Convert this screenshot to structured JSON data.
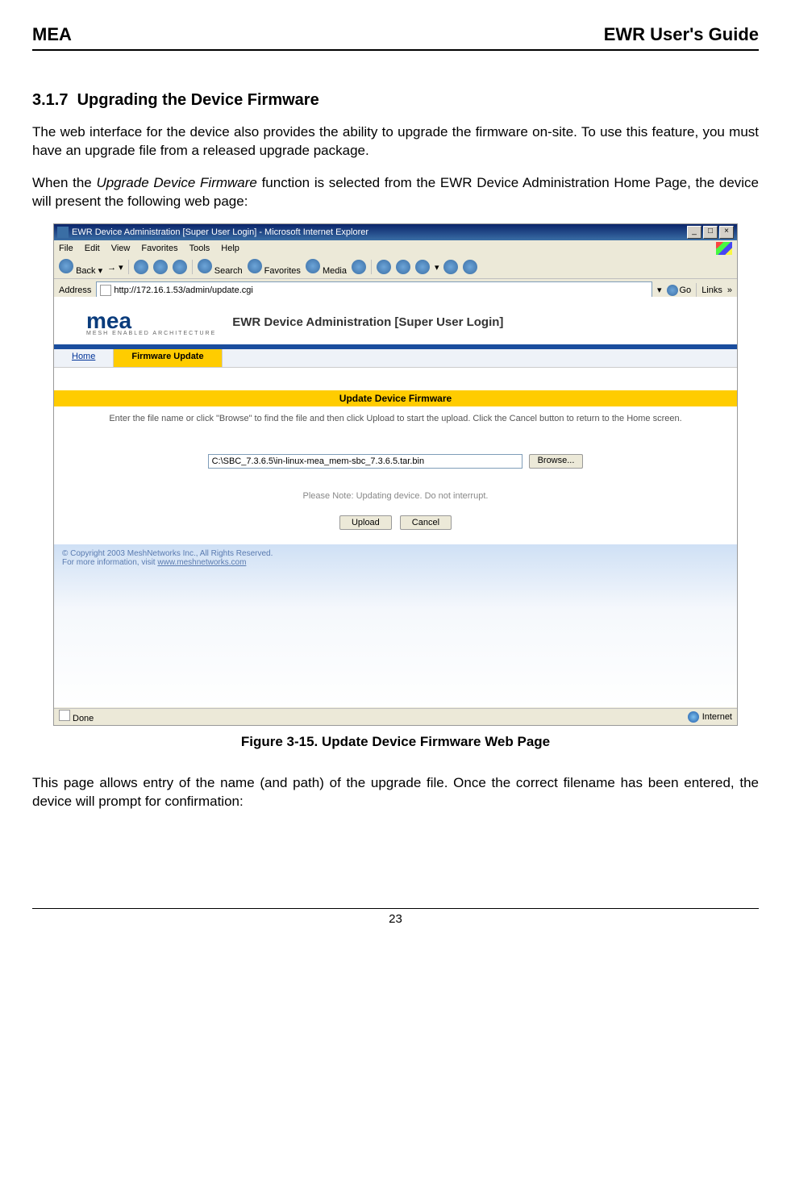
{
  "header": {
    "left": "MEA",
    "right": "EWR User's Guide"
  },
  "section": {
    "number": "3.1.7",
    "title": "Upgrading the Device Firmware"
  },
  "para1": "The web interface for the device also provides the ability to upgrade the firmware on-site. To use this feature, you must have an upgrade file from a released upgrade package.",
  "para2_prefix": "When the ",
  "para2_italic": "Upgrade Device Firmware",
  "para2_suffix": " function is selected from the EWR Device Administration Home Page, the device will present the following web page:",
  "browser": {
    "title": "EWR Device Administration [Super User Login] - Microsoft Internet Explorer",
    "menus": [
      "File",
      "Edit",
      "View",
      "Favorites",
      "Tools",
      "Help"
    ],
    "toolbar": {
      "back": "Back",
      "search": "Search",
      "favorites": "Favorites",
      "media": "Media"
    },
    "address_label": "Address",
    "address_value": "http://172.16.1.53/admin/update.cgi",
    "go": "Go",
    "links": "Links",
    "status_left": "Done",
    "status_right": "Internet"
  },
  "page": {
    "logo_text": "mea",
    "logo_sub": "MESH ENABLED ARCHITECTURE",
    "admin_title": "EWR Device Administration [Super User Login]",
    "tabs": {
      "home": "Home",
      "firmware": "Firmware Update"
    },
    "panel_title": "Update Device Firmware",
    "instructions": "Enter the file name or click \"Browse\" to find the file and then click Upload to start the upload. Click the Cancel button to return to the Home screen.",
    "file_value": "C:\\SBC_7.3.6.5\\in-linux-mea_mem-sbc_7.3.6.5.tar.bin",
    "browse_label": "Browse...",
    "note": "Please Note: Updating device. Do not interrupt.",
    "upload_label": "Upload",
    "cancel_label": "Cancel",
    "copyright": "© Copyright 2003 MeshNetworks Inc., All Rights Reserved.",
    "moreinfo_prefix": "For more information, visit ",
    "moreinfo_link": "www.meshnetworks.com"
  },
  "figure_caption": "Figure 3-15.   Update Device Firmware Web Page",
  "para3": "This page allows entry of the name (and path) of the upgrade file. Once the correct filename has been entered, the device will prompt for confirmation:",
  "page_number": "23"
}
